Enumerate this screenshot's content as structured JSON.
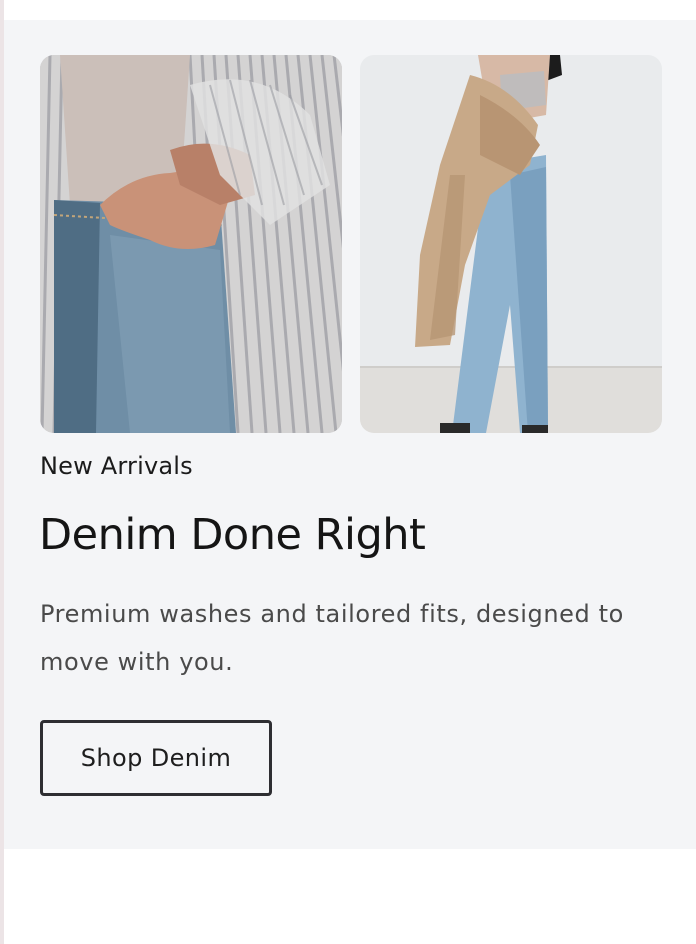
{
  "promo": {
    "eyebrow": "New Arrivals",
    "headline": "Denim Done Right",
    "description": "Premium washes and tailored fits, designed to move with you.",
    "cta_label": "Shop Denim"
  },
  "colors": {
    "section_background": "#f4f5f7",
    "headline": "#151515",
    "body_text": "#4a4a4a",
    "button_border": "#2e2e32"
  }
}
